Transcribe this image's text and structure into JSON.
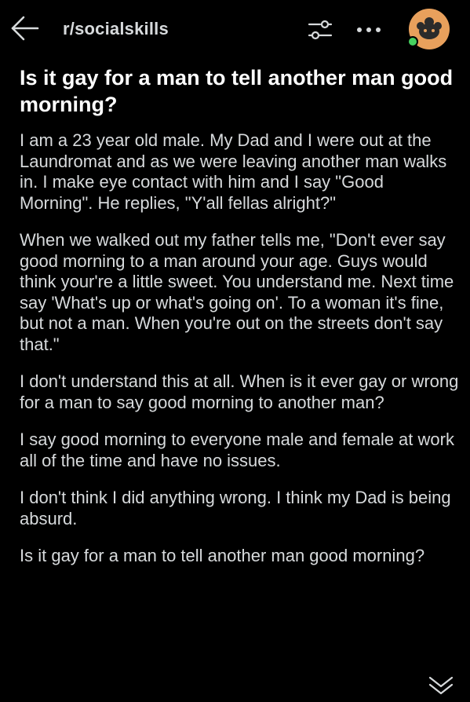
{
  "header": {
    "subreddit": "r/socialskills",
    "back_icon": "arrow-left-icon",
    "filter_icon": "sliders-icon",
    "more_icon": "ellipsis-icon",
    "avatar_icon": "snoo-avatar-icon",
    "online_color": "#46d160",
    "avatar_color": "#e8a05c"
  },
  "post": {
    "title": "Is it gay for a man to tell another man good morning?",
    "paragraphs": [
      "I am a 23 year old male. My Dad and I were out at the Laundromat and as we were leaving another man walks in. I make eye contact with him and I say \"Good Morning\". He replies, \"Y'all fellas alright?\"",
      "When we walked out my father tells me, \"Don't ever say good morning to a man around your age. Guys would think your're a little sweet. You understand me. Next time say 'What's up or what's going on'. To a woman it's fine, but not a man. When you're out on the streets don't say that.\"",
      "I don't understand this at all. When is it ever gay or wrong for a man to say good morning to another man?",
      "I say good morning to everyone male and female at work all of the time and have no issues.",
      "I don't think I did anything wrong. I think my Dad is being absurd.",
      "Is it gay for a man to tell another man good morning?"
    ],
    "collapse_icon": "double-chevron-down-icon"
  },
  "colors": {
    "background": "#000000",
    "title_text": "#ffffff",
    "body_text": "#d7dadc"
  }
}
